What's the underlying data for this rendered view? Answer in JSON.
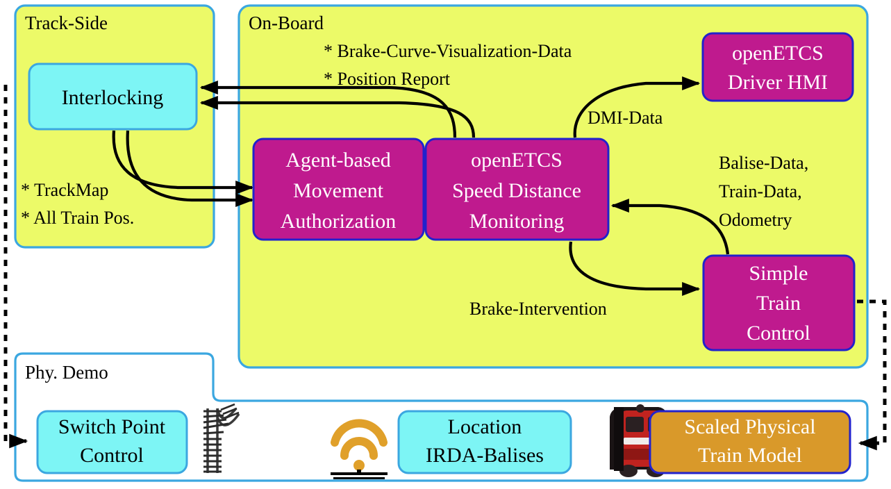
{
  "groups": {
    "track_side": {
      "label": "Track-Side",
      "fill": "#ecfa68",
      "stroke": "#3ba7e0"
    },
    "on_board": {
      "label": "On-Board",
      "fill": "#ecfa68",
      "stroke": "#3ba7e0"
    },
    "phy_demo": {
      "label": "Phy. Demo",
      "fill": "#ffffff",
      "stroke": "#3ba7e0"
    }
  },
  "nodes": {
    "interlocking": {
      "label": "Interlocking",
      "fill": "#7df5f5",
      "stroke": "#3ba7e0",
      "text": "#000000"
    },
    "agent_based_ma": {
      "line1": "Agent-based",
      "line2": "Movement",
      "line3": "Authorization",
      "fill": "#bf1a8e",
      "stroke": "#2222cc",
      "text": "#ffffff"
    },
    "open_etcs_sdm": {
      "line1": "openETCS",
      "line2": "Speed Distance",
      "line3": "Monitoring",
      "fill": "#bf1a8e",
      "stroke": "#2222cc",
      "text": "#ffffff"
    },
    "driver_hmi": {
      "line1": "openETCS",
      "line2": "Driver HMI",
      "fill": "#bf1a8e",
      "stroke": "#2222cc",
      "text": "#ffffff"
    },
    "simple_train_control": {
      "line1": "Simple",
      "line2": "Train",
      "line3": "Control",
      "fill": "#bf1a8e",
      "stroke": "#2222cc",
      "text": "#ffffff"
    },
    "switch_point_control": {
      "line1": "Switch Point",
      "line2": "Control",
      "fill": "#7df5f5",
      "stroke": "#3ba7e0",
      "text": "#000000"
    },
    "location_irda": {
      "line1": "Location",
      "line2": "IRDA-Balises",
      "fill": "#7df5f5",
      "stroke": "#3ba7e0",
      "text": "#000000"
    },
    "scaled_train_model": {
      "line1": "Scaled Physical",
      "line2": "Train Model",
      "fill": "#d9992a",
      "stroke": "#2222cc",
      "text": "#ffffff"
    }
  },
  "annotations": {
    "track_side_note_line1": "* TrackMap",
    "track_side_note_line2": "* All Train Pos.",
    "on_board_note_line1": "* Brake-Curve-Visualization-Data",
    "on_board_note_line2": "* Position Report",
    "dmi_data": "DMI-Data",
    "balise_line1": "Balise-Data,",
    "balise_line2": "Train-Data,",
    "balise_line3": "Odometry",
    "brake_intervention": "Brake-Intervention"
  },
  "icons": {
    "track_switch": "railway-switch-icon",
    "wifi_balise": "wifi-balise-icon",
    "train_photo": "train-photo-icon"
  },
  "colors": {
    "group_yellow": "#ecfa68",
    "node_cyan": "#7df5f5",
    "node_magenta": "#bf1a8e",
    "node_orange": "#d9992a",
    "border_blue": "#3ba7e0",
    "border_darkblue": "#2222cc",
    "wifi_orange": "#e0a02a",
    "edge_black": "#000000"
  }
}
